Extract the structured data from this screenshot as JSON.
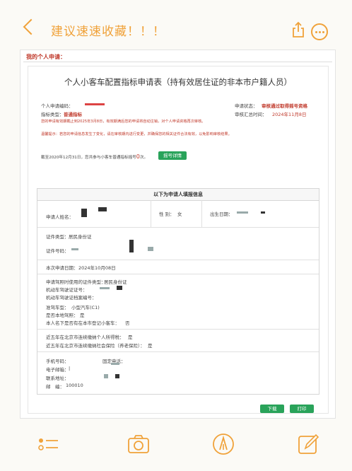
{
  "app": {
    "title": "建议速速收藏！！！"
  },
  "page": {
    "section_label": "我的个人申请：",
    "form_title": "个人小客车配置指标申请表（持有效居住证的非本市户籍人员）",
    "applicant_code_label": "个人申请编码：",
    "status_label": "申请状态：",
    "status_value": "审核通过取得摇号资格",
    "type_label": "指标类型：",
    "type_value": "普通指标",
    "summary_label": "审核汇总时间：",
    "summary_value": "2024年11月8日",
    "valid_note": "您的申请有效期截止到2025年3月8日，有效期满后您的申请将自动注销，对个人申请资格再次审核。",
    "warm_tip": "温馨提示：若您的申请信息发生了变化，请在审核期内进行变更，并确保您的相关证件合法有效，以免影响审核结果。",
    "lottery_note_prefix": "截至2020年12月31日，您共参与小客车普通指标摇号",
    "lottery_count": "0",
    "lottery_note_suffix": "次。",
    "lottery_detail_button": "摇号详情",
    "table_header": "以下为申请人填报信息",
    "name_label": "申请人姓名：",
    "gender_label": "性 别：",
    "gender_value": "女",
    "birth_label": "出生日期：",
    "id_type_label": "证件类型：",
    "id_type_value": "居民身份证",
    "id_no_label": "证件号码：",
    "apply_date_label": "本次申请日期：",
    "apply_date_value": "2024年10月08日",
    "license_type_label": "申请驾照时使用的证件类型：",
    "license_type_value": "居民身份证",
    "license_no_label": "机动车驾驶证证号：",
    "license_archive_label": "机动车驾驶证档案编号：",
    "car_type_label": "准驾车型：",
    "car_type_value": "小型汽车(C1)",
    "local_license_label": "是否本地驾照：",
    "local_license_value": "是",
    "has_car_label": "本人名下是否有在本市登记小客车：",
    "has_car_value": "否",
    "tax_label": "近五年在北京市连续缴纳个人所得税：",
    "tax_value": "是",
    "insurance_label": "近五年在北京市连续缴纳社会保险（养老保险）：",
    "insurance_value": "是",
    "phone_label": "手机号码：",
    "landline_label": "固定电话：",
    "email_label": "电子邮箱：",
    "email_value": "|",
    "address_label": "联系地址：",
    "postcode_label": "邮　编：",
    "postcode_value": "100010",
    "change_button": "下载",
    "print_button": "打印"
  },
  "toolbar": {
    "items": [
      "checklist-icon",
      "camera-icon",
      "pen-icon",
      "edit-icon"
    ]
  },
  "colors": {
    "accent": "#f0a23a",
    "green": "#29a35a",
    "red": "#c0392b"
  }
}
